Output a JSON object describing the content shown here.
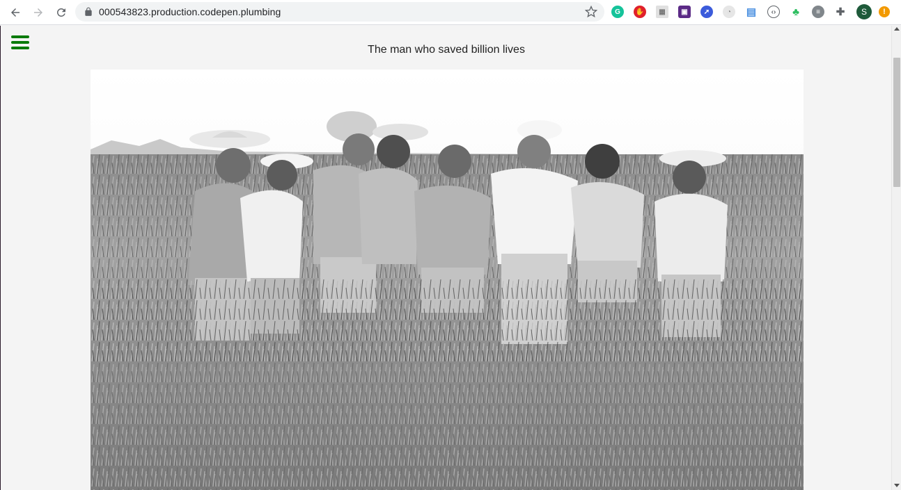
{
  "browser": {
    "url": "000543823.production.codepen.plumbing",
    "profile_initial": "S",
    "alert_glyph": "!",
    "extensions": [
      {
        "icon": "grammarly-icon",
        "color": "#15c39a",
        "glyph": "G"
      },
      {
        "icon": "adblock-icon",
        "color": "#e0202b",
        "glyph": "✋"
      },
      {
        "icon": "qr-icon",
        "color": "#d0d0d0",
        "glyph": "▦"
      },
      {
        "icon": "screencast-icon",
        "color": "#5b2a86",
        "glyph": "▣"
      },
      {
        "icon": "rocket-icon",
        "color": "#3b5bdb",
        "glyph": "➚"
      },
      {
        "icon": "timer-icon",
        "color": "#bdbdbd",
        "glyph": "◔"
      },
      {
        "icon": "save-icon",
        "color": "#4a8fe0",
        "glyph": "▤"
      },
      {
        "icon": "code-icon",
        "color": "#5f6368",
        "glyph": "‹›"
      },
      {
        "icon": "evernote-icon",
        "color": "#2dbe60",
        "glyph": "♣"
      },
      {
        "icon": "chat-icon",
        "color": "#80868b",
        "glyph": "≡"
      },
      {
        "icon": "puzzle-icon",
        "color": "#5f6368",
        "glyph": "✚"
      }
    ]
  },
  "page": {
    "title": "The man who saved billion lives"
  },
  "colors": {
    "accent": "#0b7a0b"
  }
}
